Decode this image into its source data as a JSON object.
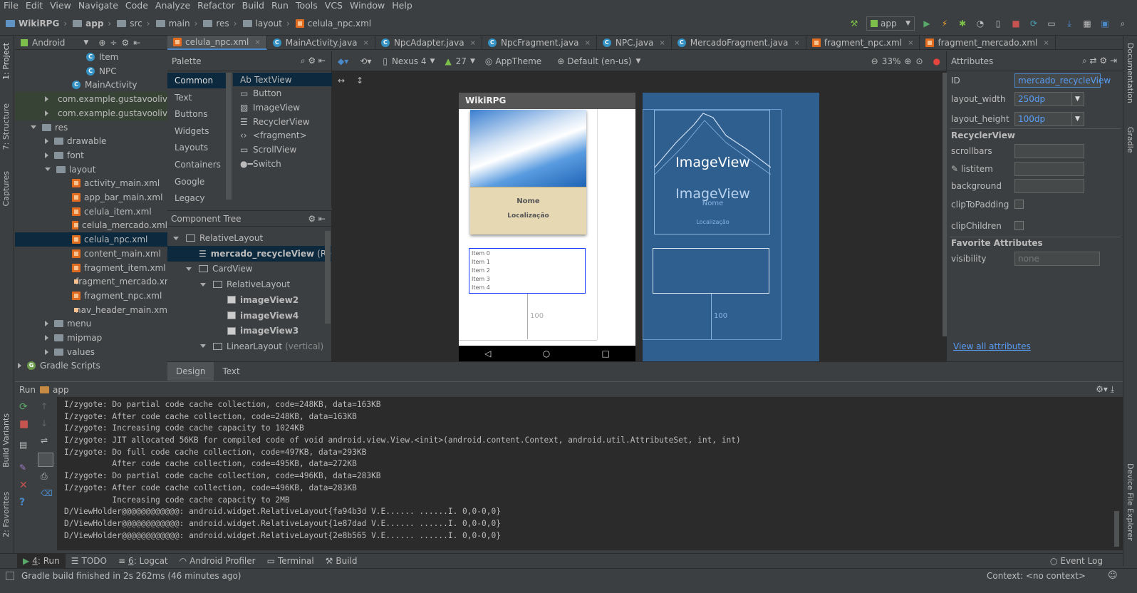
{
  "menu": [
    "File",
    "Edit",
    "View",
    "Navigate",
    "Code",
    "Analyze",
    "Refactor",
    "Build",
    "Run",
    "Tools",
    "VCS",
    "Window",
    "Help"
  ],
  "breadcrumbs": [
    "WikiRPG",
    "app",
    "src",
    "main",
    "res",
    "layout",
    "celula_npc.xml"
  ],
  "run_config": "app",
  "project": {
    "view_selector": "Android",
    "tree": [
      {
        "label": "Item",
        "type": "class"
      },
      {
        "label": "NPC",
        "type": "class"
      },
      {
        "label": "MainActivity",
        "type": "class"
      },
      {
        "label": "com.example.gustavooliv",
        "type": "package"
      },
      {
        "label": "com.example.gustavooliv",
        "type": "package"
      },
      {
        "label": "res",
        "type": "folder"
      },
      {
        "label": "drawable",
        "type": "folder"
      },
      {
        "label": "font",
        "type": "folder"
      },
      {
        "label": "layout",
        "type": "folder"
      },
      {
        "label": "activity_main.xml",
        "type": "xml"
      },
      {
        "label": "app_bar_main.xml",
        "type": "xml"
      },
      {
        "label": "celula_item.xml",
        "type": "xml"
      },
      {
        "label": "celula_mercado.xml",
        "type": "xml"
      },
      {
        "label": "celula_npc.xml",
        "type": "xml"
      },
      {
        "label": "content_main.xml",
        "type": "xml"
      },
      {
        "label": "fragment_item.xml",
        "type": "xml"
      },
      {
        "label": "fragment_mercado.xm",
        "type": "xml"
      },
      {
        "label": "fragment_npc.xml",
        "type": "xml"
      },
      {
        "label": "nav_header_main.xml",
        "type": "xml"
      },
      {
        "label": "menu",
        "type": "folder"
      },
      {
        "label": "mipmap",
        "type": "folder"
      },
      {
        "label": "values",
        "type": "folder"
      },
      {
        "label": "Gradle Scripts",
        "type": "gradle"
      }
    ]
  },
  "editor_tabs": [
    "celula_npc.xml",
    "MainActivity.java",
    "NpcAdapter.java",
    "NpcFragment.java",
    "NPC.java",
    "MercadoFragment.java",
    "fragment_npc.xml",
    "fragment_mercado.xml"
  ],
  "design_toolbar": {
    "device": "Nexus 4",
    "api": "27",
    "theme": "AppTheme",
    "locale": "Default (en-us)",
    "zoom": "33%"
  },
  "palette": {
    "title": "Palette",
    "categories": [
      "Common",
      "Text",
      "Buttons",
      "Widgets",
      "Layouts",
      "Containers",
      "Google",
      "Legacy"
    ],
    "items": [
      "TextView",
      "Button",
      "ImageView",
      "RecyclerView",
      "<fragment>",
      "ScrollView",
      "Switch"
    ],
    "first_item_prefix": "Ab"
  },
  "component_tree": {
    "title": "Component Tree",
    "nodes": [
      {
        "label": "RelativeLayout",
        "extra": ""
      },
      {
        "label": "mercado_recycleView",
        "extra": "(Recycle"
      },
      {
        "label": "CardView",
        "extra": ""
      },
      {
        "label": "RelativeLayout",
        "extra": ""
      },
      {
        "label": "imageView2",
        "extra": ""
      },
      {
        "label": "imageView4",
        "extra": ""
      },
      {
        "label": "imageView3",
        "extra": ""
      },
      {
        "label": "LinearLayout",
        "extra": "(vertical)"
      }
    ]
  },
  "preview": {
    "app_title": "WikiRPG",
    "card_name": "Nome",
    "card_location": "Localização",
    "list_items": [
      "Item 0",
      "Item 1",
      "Item 2",
      "Item 3",
      "Item 4"
    ],
    "dimension_label": "100",
    "blueprint_imageview": "ImageView",
    "blueprint_imageview2": "ImageView",
    "blueprint_name": "Nome",
    "blueprint_location": "Localização"
  },
  "attributes": {
    "title": "Attributes",
    "id_label": "ID",
    "id_value": "mercado_recycleView",
    "width_label": "layout_width",
    "width_value": "250dp",
    "height_label": "layout_height",
    "height_value": "100dp",
    "section": "RecyclerView",
    "scrollbars": "scrollbars",
    "listitem": "listitem",
    "background": "background",
    "clipToPadding": "clipToPadding",
    "clipChildren": "clipChildren",
    "fav_section": "Favorite Attributes",
    "visibility": "visibility",
    "visibility_value": "none",
    "view_all": "View all attributes"
  },
  "design_tabs": [
    "Design",
    "Text"
  ],
  "run": {
    "label": "Run",
    "config": "app"
  },
  "console_lines": [
    "I/zygote: Do partial code cache collection, code=248KB, data=163KB",
    "I/zygote: After code cache collection, code=248KB, data=163KB",
    "I/zygote: Increasing code cache capacity to 1024KB",
    "I/zygote: JIT allocated 56KB for compiled code of void android.view.View.<init>(android.content.Context, android.util.AttributeSet, int, int)",
    "I/zygote: Do full code cache collection, code=497KB, data=293KB",
    "          After code cache collection, code=495KB, data=272KB",
    "I/zygote: Do partial code cache collection, code=496KB, data=283KB",
    "I/zygote: After code cache collection, code=496KB, data=283KB",
    "          Increasing code cache capacity to 2MB",
    "D/ViewHolder@@@@@@@@@@@@: android.widget.RelativeLayout{fa94b3d V.E...... ......I. 0,0-0,0}",
    "D/ViewHolder@@@@@@@@@@@@: android.widget.RelativeLayout{1e87dad V.E...... ......I. 0,0-0,0}",
    "D/ViewHolder@@@@@@@@@@@@: android.widget.RelativeLayout{2e8b565 V.E...... ......I. 0,0-0,0}"
  ],
  "bottom_tools": [
    {
      "num": "4",
      "label": ": Run"
    },
    {
      "num": "",
      "label": "TODO"
    },
    {
      "num": "6",
      "label": ": Logcat"
    },
    {
      "num": "",
      "label": "Android Profiler"
    },
    {
      "num": "",
      "label": "Terminal"
    },
    {
      "num": "",
      "label": "Build"
    }
  ],
  "event_log": "Event Log",
  "status": "Gradle build finished in 2s 262ms (46 minutes ago)",
  "context": "Context: <no context>",
  "left_strip": [
    "1: Project",
    "7: Structure",
    "Captures",
    "Build Variants",
    "2: Favorites"
  ],
  "right_strip": [
    "Documentation",
    "Gradle",
    "Device File Explorer"
  ],
  "colors": {
    "accent": "#4a88c7",
    "selection": "#0d293e",
    "blueprint": "#2e5f8f",
    "blue_text": "#589df6"
  }
}
